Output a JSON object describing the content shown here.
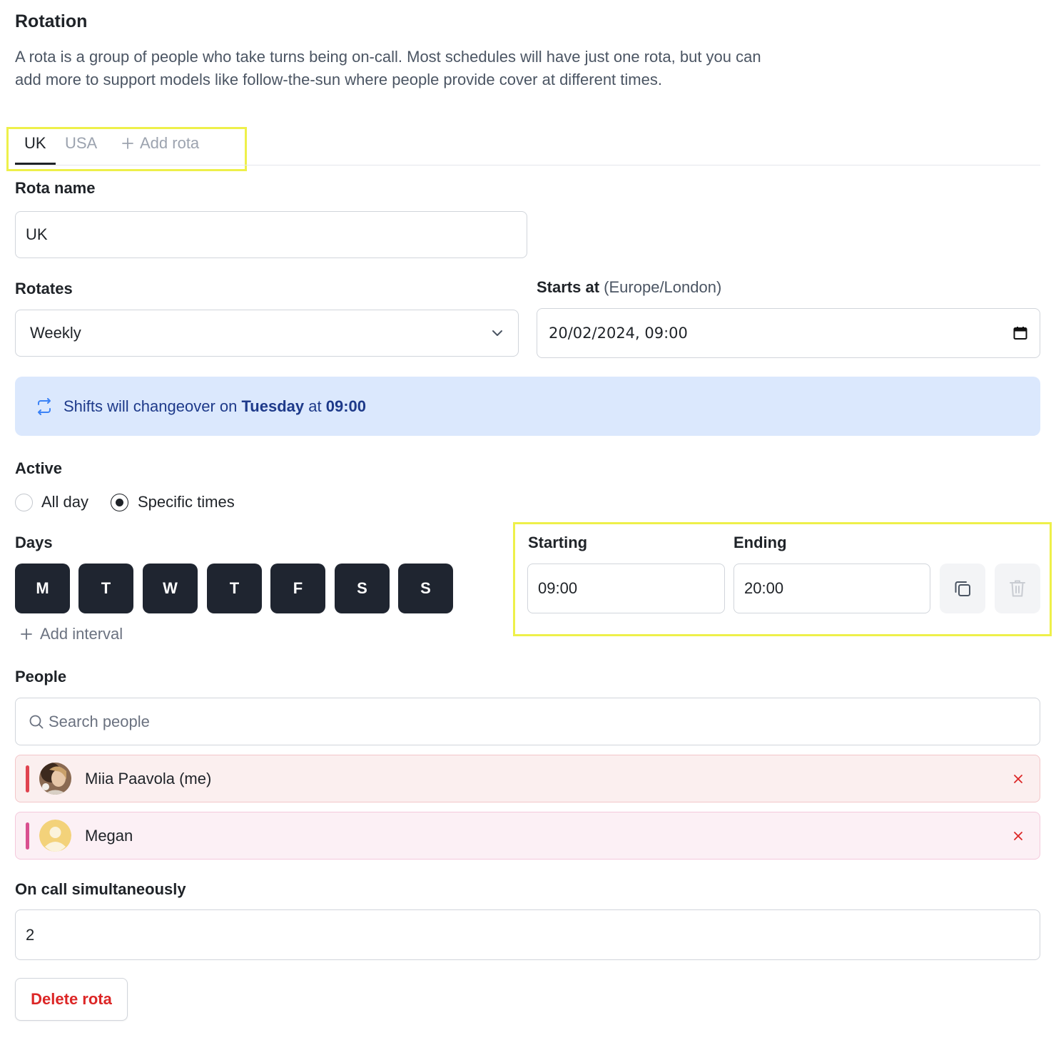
{
  "section": {
    "title": "Rotation",
    "description": "A rota is a group of people who take turns being on-call. Most schedules will have just one rota, but you can add more to support models like follow-the-sun where people provide cover at different times."
  },
  "tabs": {
    "items": [
      "UK",
      "USA"
    ],
    "active": "UK",
    "add_label": "Add rota"
  },
  "rota_name": {
    "label": "Rota name",
    "value": "UK"
  },
  "rotates": {
    "label": "Rotates",
    "value": "Weekly"
  },
  "starts_at": {
    "label": "Starts at",
    "timezone": "(Europe/London)",
    "value": "20/02/2024, 09:00"
  },
  "banner": {
    "prefix": "Shifts will changeover on",
    "day": "Tuesday",
    "mid": "at",
    "time": "09:00"
  },
  "active": {
    "label": "Active",
    "options": [
      "All day",
      "Specific times"
    ],
    "selected": "Specific times"
  },
  "days": {
    "label": "Days",
    "items": [
      "M",
      "T",
      "W",
      "T",
      "F",
      "S",
      "S"
    ],
    "add_interval": "Add interval"
  },
  "times": {
    "starting_label": "Starting",
    "starting_value": "09:00",
    "ending_label": "Ending",
    "ending_value": "20:00"
  },
  "people": {
    "label": "People",
    "search_placeholder": "Search people",
    "list": [
      {
        "name": "Miia Paavola (me)",
        "bar_color": "#e0434f",
        "bg_color": "#fbefef",
        "border_color": "#f3c6c9"
      },
      {
        "name": "Megan",
        "bar_color": "#d94f8f",
        "bg_color": "#fcf0f5",
        "border_color": "#f4c9dc"
      }
    ]
  },
  "on_call": {
    "label": "On call simultaneously",
    "value": "2"
  },
  "delete_label": "Delete rota"
}
